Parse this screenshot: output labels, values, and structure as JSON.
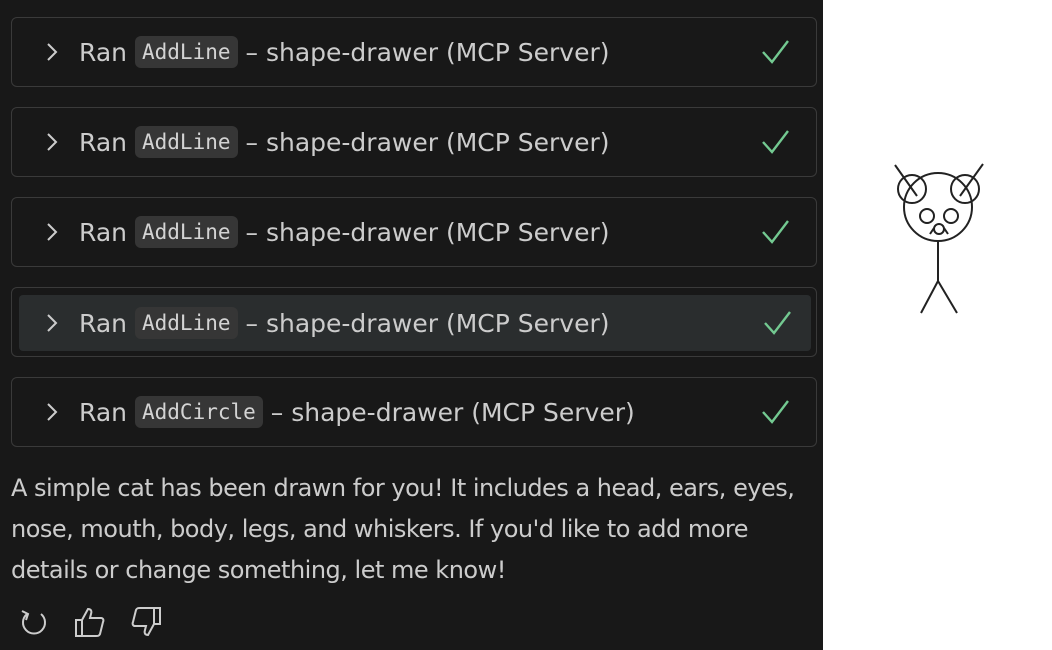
{
  "tool_calls": [
    {
      "prefix": "Ran",
      "tool": "AddLine",
      "suffix": "– shape-drawer (MCP Server)",
      "status_icon": "check-icon"
    },
    {
      "prefix": "Ran",
      "tool": "AddLine",
      "suffix": "– shape-drawer (MCP Server)",
      "status_icon": "check-icon"
    },
    {
      "prefix": "Ran",
      "tool": "AddLine",
      "suffix": "– shape-drawer (MCP Server)",
      "status_icon": "check-icon"
    },
    {
      "prefix": "Ran",
      "tool": "AddLine",
      "suffix": "– shape-drawer (MCP Server)",
      "status_icon": "check-icon"
    },
    {
      "prefix": "Ran",
      "tool": "AddCircle",
      "suffix": "– shape-drawer (MCP Server)",
      "status_icon": "check-icon"
    }
  ],
  "message": {
    "text": "A simple cat has been drawn for you! It includes a head, ears, eyes, nose, mouth, body, legs, and whiskers. If you'd like to add more details or change something, let me know!"
  },
  "actions": [
    {
      "icon": "retry-icon"
    },
    {
      "icon": "thumbs-up-icon"
    },
    {
      "icon": "thumbs-down-icon"
    }
  ],
  "colors": {
    "panel_bg": "#181818",
    "card_border": "#3a3a3a",
    "hover_bg": "#2a2d2e",
    "text": "#cccccc",
    "chip_bg": "#363636",
    "check": "#73c991",
    "canvas_bg": "#ffffff",
    "drawing_stroke": "#222222"
  }
}
